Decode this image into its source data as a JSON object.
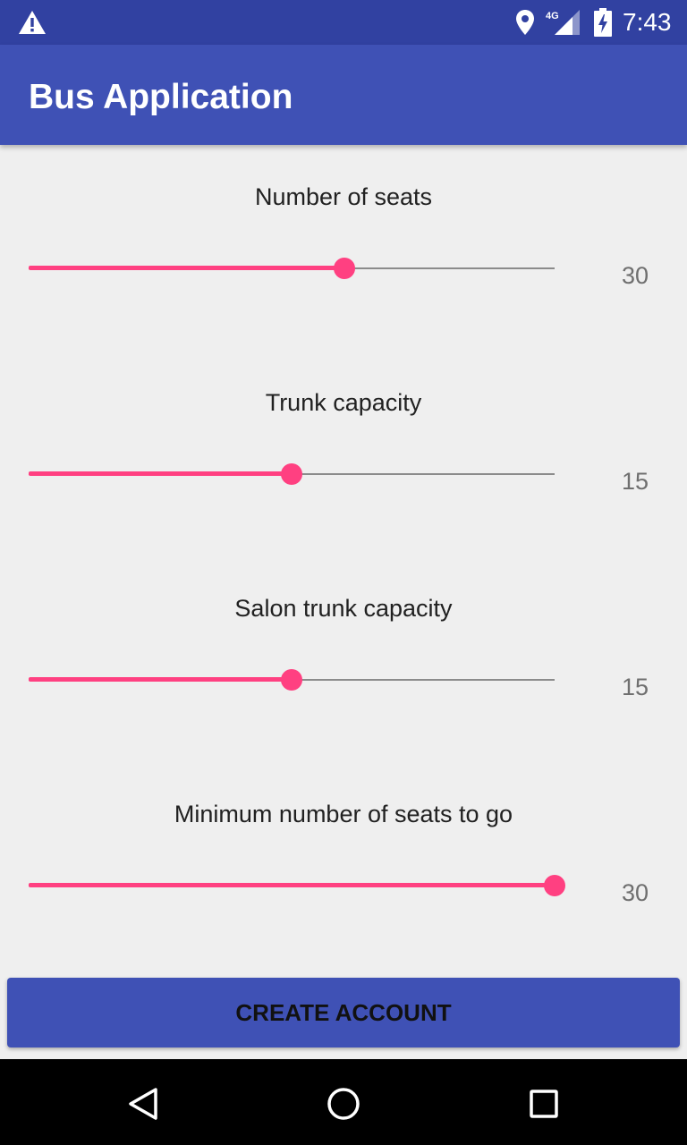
{
  "status_bar": {
    "time": "7:43",
    "network": "4G",
    "icons": [
      "warning-icon",
      "location-icon",
      "signal-4g-icon",
      "battery-charging-icon"
    ]
  },
  "app_bar": {
    "title": "Bus Application"
  },
  "sliders": [
    {
      "label": "Number of seats",
      "value": "30",
      "fraction": 0.6
    },
    {
      "label": "Trunk capacity",
      "value": "15",
      "fraction": 0.5
    },
    {
      "label": "Salon trunk capacity",
      "value": "15",
      "fraction": 0.5
    },
    {
      "label": "Minimum number of seats to go",
      "value": "30",
      "fraction": 1.0
    }
  ],
  "create_button": {
    "label": "CREATE ACCOUNT"
  },
  "nav_bar": {
    "icons": [
      "back-icon",
      "home-icon",
      "recents-icon"
    ]
  },
  "colors": {
    "status_bar": "#3141a1",
    "primary": "#3f51b5",
    "accent": "#ff4081",
    "background": "#efefef"
  }
}
